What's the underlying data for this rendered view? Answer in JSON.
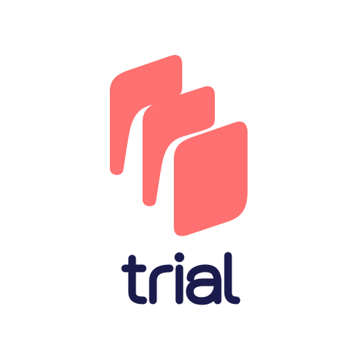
{
  "brand": {
    "name": "trial",
    "mark_color": "#FF7070",
    "text_color": "#1B1C4D"
  },
  "logo": {
    "icon": "stacked-cards-icon",
    "card_count": 3
  }
}
